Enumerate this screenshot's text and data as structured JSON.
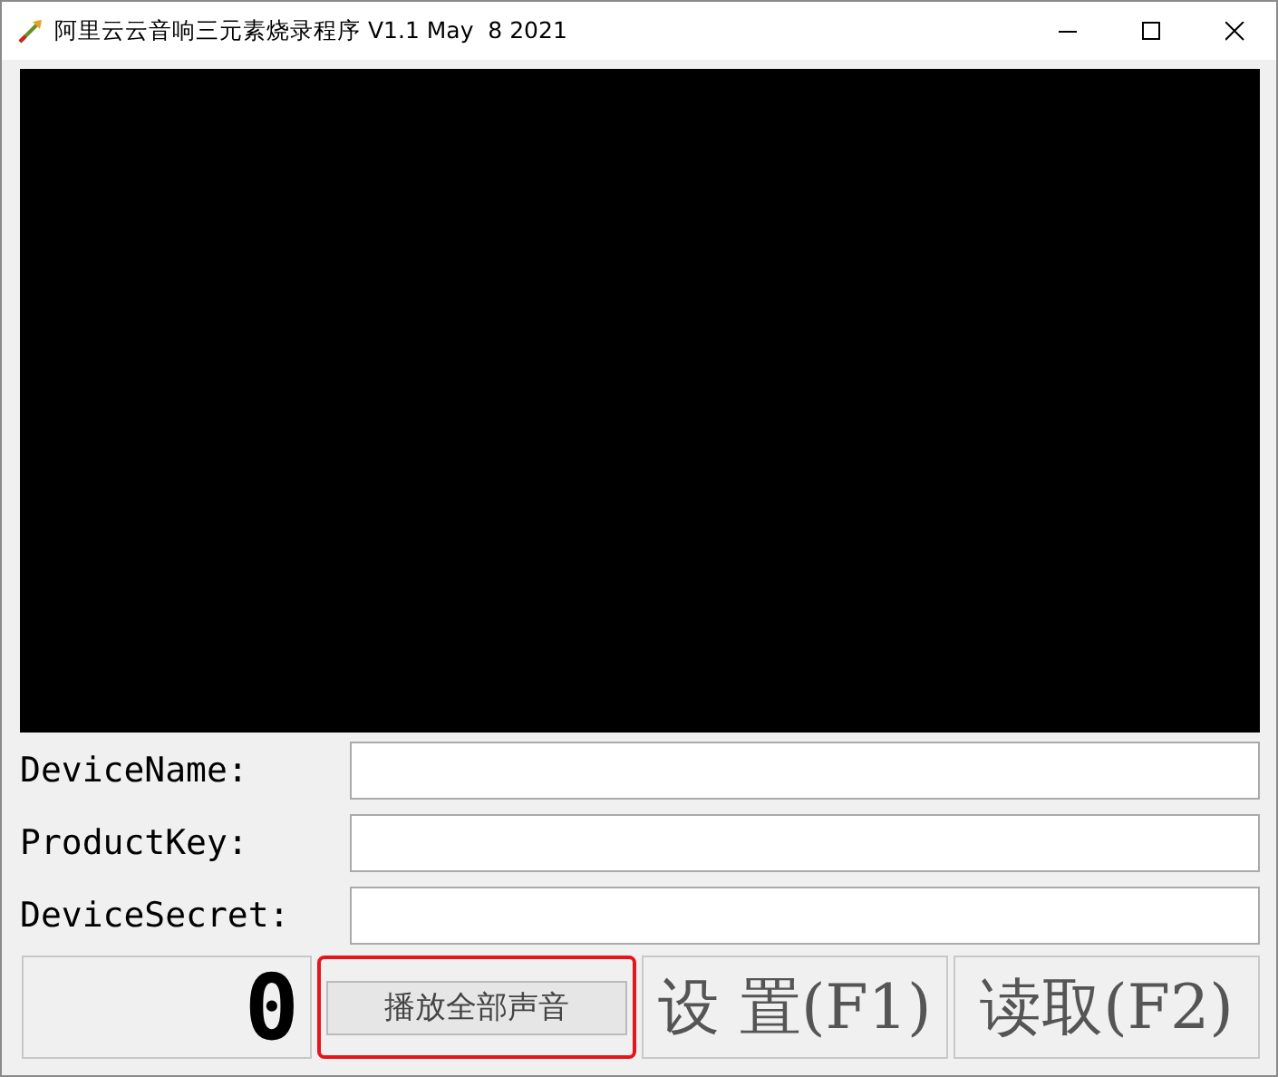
{
  "window": {
    "title": "阿里云云音响三元素烧录程序 V1.1 May  8 2021"
  },
  "fields": [
    {
      "label": "DeviceName:"
    },
    {
      "label": "ProductKey:"
    },
    {
      "label": "DeviceSecret:"
    }
  ],
  "counter": "0",
  "play_button": {
    "label": "播放全部声音",
    "highlighted": true
  },
  "buttons": [
    {
      "label": "设 置(F1)"
    },
    {
      "label": "读取(F2)"
    }
  ]
}
